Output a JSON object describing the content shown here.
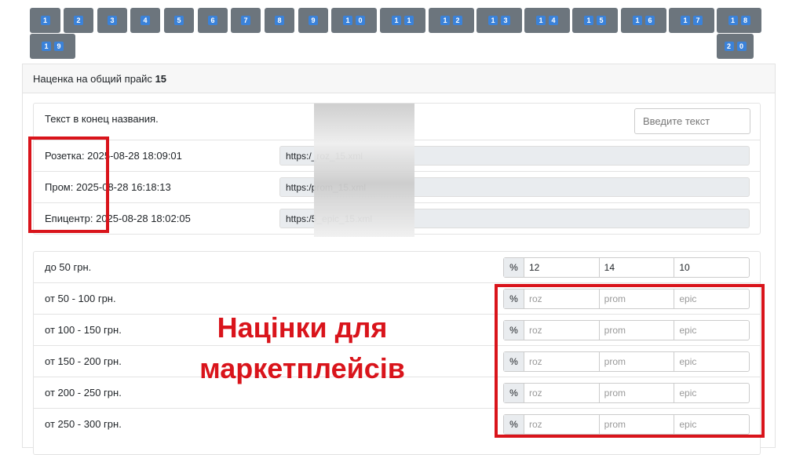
{
  "pages": [
    "1",
    "2",
    "3",
    "4",
    "5",
    "6",
    "7",
    "8",
    "9",
    "10",
    "11",
    "12",
    "13",
    "14",
    "15",
    "16",
    "17",
    "18",
    "19",
    "20"
  ],
  "header": {
    "label": "Наценка на общий прайс",
    "value": "15"
  },
  "name_suffix": {
    "label": "Текст в конец названия.",
    "placeholder": "Введите текст"
  },
  "feeds": [
    {
      "label": "Розетка: 2025-08-28 18:09:01",
      "url": "https:/_roz_15.xml"
    },
    {
      "label": "Пром: 2025-08-28 16:18:13",
      "url": "https:/prom_15.xml"
    },
    {
      "label": "Епицентр: 2025-08-28 18:02:05",
      "url": "https:/5_epic_15.xml"
    }
  ],
  "percent_symbol": "%",
  "placeholders": {
    "roz": "roz",
    "prom": "prom",
    "epic": "epic"
  },
  "ranges": [
    {
      "label": "до 50 грн.",
      "roz": "12",
      "prom": "14",
      "epic": "10"
    },
    {
      "label": "от 50 - 100 грн.",
      "roz": "",
      "prom": "",
      "epic": ""
    },
    {
      "label": "от 100 - 150 грн.",
      "roz": "",
      "prom": "",
      "epic": ""
    },
    {
      "label": "от 150 - 200 грн.",
      "roz": "",
      "prom": "",
      "epic": ""
    },
    {
      "label": "от 200 - 250 грн.",
      "roz": "",
      "prom": "",
      "epic": ""
    },
    {
      "label": "от 250 - 300 грн.",
      "roz": "",
      "prom": "",
      "epic": ""
    }
  ],
  "annotation": "Націнки для маркетплейсів",
  "colors": {
    "button": "#6c757d",
    "keycap": "#3b82d9",
    "annotation": "#d9141b"
  }
}
